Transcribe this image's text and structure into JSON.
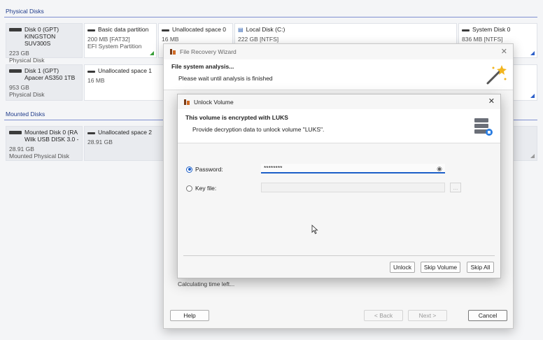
{
  "physical_disks": {
    "title": "Physical Disks",
    "disk0": {
      "line1": "Disk 0 (GPT)",
      "line2": "KINGSTON SUV300S",
      "size": "223 GB",
      "type": "Physical Disk",
      "partitions": [
        {
          "name": "Basic data partition",
          "size": "200 MB [FAT32]",
          "fs": "EFI System Partition"
        },
        {
          "name": "Unallocated space 0",
          "size": "16 MB"
        },
        {
          "name": "Local Disk (C:)",
          "size": "222 GB [NTFS]"
        },
        {
          "name": "System Disk 0",
          "size": "836 MB [NTFS]"
        }
      ]
    },
    "disk1": {
      "line1": "Disk 1 (GPT)",
      "line2": "Apacer AS350 1TB",
      "size": "953 GB",
      "type": "Physical Disk",
      "partitions": [
        {
          "name": "Unallocated space 1",
          "size": "16 MB"
        }
      ]
    }
  },
  "mounted_disks": {
    "title": "Mounted Disks",
    "disk0": {
      "line1": "Mounted Disk 0 (RA",
      "line2": "Wilk USB DISK 3.0 -",
      "size": "28.91 GB",
      "type": "Mounted Physical Disk",
      "partitions": [
        {
          "name": "Unallocated space 2",
          "size": "28.91 GB"
        }
      ]
    }
  },
  "wizard": {
    "title": "File Recovery Wizard",
    "heading": "File system analysis...",
    "subheading": "Please wait until analysis is finished",
    "status": "Calculating time left...",
    "buttons": {
      "help": "Help",
      "back": "< Back",
      "next": "Next >",
      "cancel": "Cancel"
    }
  },
  "unlock": {
    "title": "Unlock Volume",
    "heading": "This volume is encrypted with LUKS",
    "subheading": "Provide decryption data to unlock volume \"LUKS\".",
    "password_label": "Password:",
    "password_value": "********",
    "keyfile_label": "Key file:",
    "keyfile_value": "",
    "browse_label": "...",
    "buttons": {
      "unlock": "Unlock",
      "skip_volume": "Skip Volume",
      "skip_all": "Skip All"
    }
  }
}
